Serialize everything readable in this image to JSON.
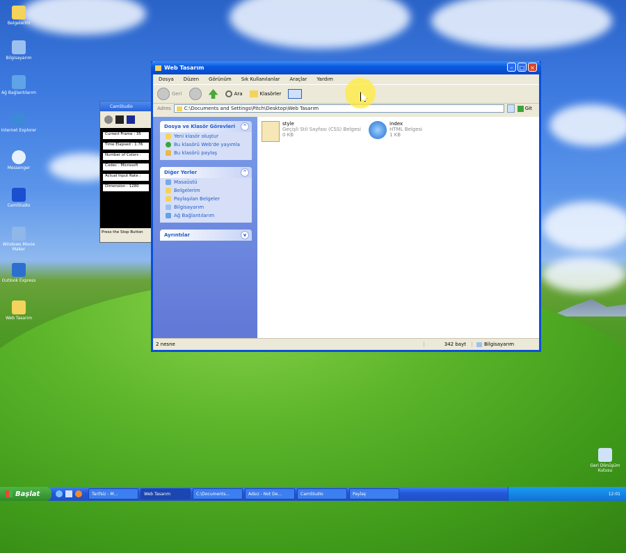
{
  "desktop": {
    "icons": [
      "Belgelerim",
      "Bilgisayarım",
      "Ağ Bağlantılarım",
      "Internet Explorer",
      "Messenger",
      "CamStudio",
      "Windows Movie Maker",
      "Outlook Express",
      "Web Tasarım"
    ],
    "recycle_bin": "Geri Dönüşüm Kutusu"
  },
  "recorder": {
    "title": "CamStudio",
    "rows": [
      "Current Frame : 35",
      "Time Elapsed : 1.76",
      "Number of Colors :",
      "Codec : Microsoft",
      "Actual Input Rate :",
      "Dimension : 1280"
    ],
    "footer": "Press the Stop Button"
  },
  "window": {
    "title": "Web Tasarım",
    "menu": [
      "Dosya",
      "Düzen",
      "Görünüm",
      "Sık Kullanılanlar",
      "Araçlar",
      "Yardım"
    ],
    "toolbar": {
      "back": "Geri",
      "search": "Ara",
      "folders": "Klasörler"
    },
    "address_label": "Adres",
    "address": "C:\\Documents and Settings\\Pitch\\Desktop\\Web Tasarım",
    "go": "Git",
    "panels": [
      {
        "title": "Dosya ve Klasör Görevleri",
        "items": [
          "Yeni klasör oluştur",
          "Bu klasörü Web'de yayımla",
          "Bu klasörü paylaş"
        ]
      },
      {
        "title": "Diğer Yerler",
        "items": [
          "Masaüstü",
          "Belgelerim",
          "Paylaşılan Belgeler",
          "Bilgisayarım",
          "Ağ Bağlantılarım"
        ]
      },
      {
        "title": "Ayrıntılar",
        "items": []
      }
    ],
    "files": [
      {
        "name": "style",
        "type": "Geçişli Stil Sayfası (CSS) Belgesi",
        "size": "0 KB"
      },
      {
        "name": "index",
        "type": "HTML Belgesi",
        "size": "1 KB"
      }
    ],
    "status": {
      "left": "2 nesne",
      "size": "342 bayt",
      "zone": "Bilgisayarım"
    }
  },
  "taskbar": {
    "start": "Başlat",
    "tasks": [
      "Tarifsiz - M...",
      "Web Tasarım",
      "C:\\Documents...",
      "Adsız - Not De...",
      "CamStudio",
      "Paylaş"
    ],
    "clock": "12:01"
  }
}
